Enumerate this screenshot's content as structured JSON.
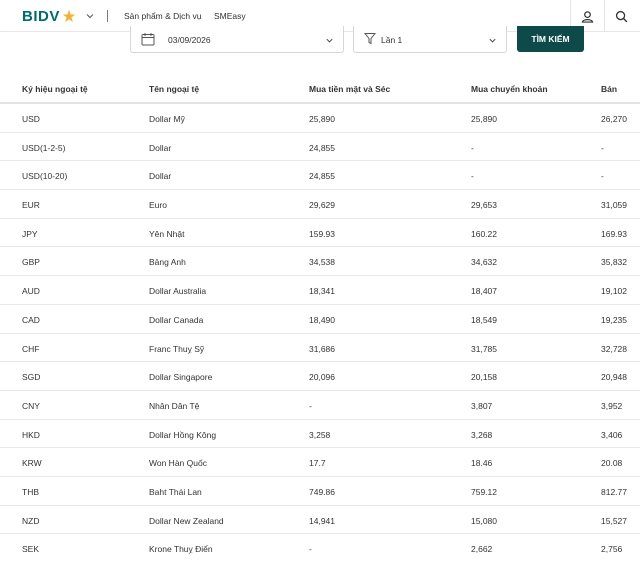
{
  "header": {
    "logo_text": "BIDV",
    "nav": [
      {
        "label": "Sản phẩm & Dịch vụ"
      },
      {
        "label": "SMEasy"
      }
    ]
  },
  "filter": {
    "date_value": "03/09/2026",
    "time_value": "Lần 1",
    "search_label": "TÌM KIẾM"
  },
  "colors": {
    "brand": "#006b68",
    "logo_star": "#f2b233",
    "button": "#0f4a4a"
  },
  "table": {
    "headers": [
      "Ký hiệu ngoại tệ",
      "Tên ngoại tệ",
      "Mua tiền mặt và Séc",
      "Mua chuyển khoản",
      "Bán"
    ],
    "rows": [
      {
        "code": "USD",
        "name": "Dollar Mỹ",
        "cash": "25,890",
        "transfer": "25,890",
        "sell": "26,270"
      },
      {
        "code": "USD(1-2-5)",
        "name": "Dollar",
        "cash": "24,855",
        "transfer": "-",
        "sell": "-"
      },
      {
        "code": "USD(10-20)",
        "name": "Dollar",
        "cash": "24,855",
        "transfer": "-",
        "sell": "-"
      },
      {
        "code": "EUR",
        "name": "Euro",
        "cash": "29,629",
        "transfer": "29,653",
        "sell": "31,059"
      },
      {
        "code": "JPY",
        "name": "Yên Nhật",
        "cash": "159.93",
        "transfer": "160.22",
        "sell": "169.93"
      },
      {
        "code": "GBP",
        "name": "Bảng Anh",
        "cash": "34,538",
        "transfer": "34,632",
        "sell": "35,832"
      },
      {
        "code": "AUD",
        "name": "Dollar Australia",
        "cash": "18,341",
        "transfer": "18,407",
        "sell": "19,102"
      },
      {
        "code": "CAD",
        "name": "Dollar Canada",
        "cash": "18,490",
        "transfer": "18,549",
        "sell": "19,235"
      },
      {
        "code": "CHF",
        "name": "Franc Thuỵ Sỹ",
        "cash": "31,686",
        "transfer": "31,785",
        "sell": "32,728"
      },
      {
        "code": "SGD",
        "name": "Dollar Singapore",
        "cash": "20,096",
        "transfer": "20,158",
        "sell": "20,948"
      },
      {
        "code": "CNY",
        "name": "Nhân Dân Tệ",
        "cash": "-",
        "transfer": "3,807",
        "sell": "3,952"
      },
      {
        "code": "HKD",
        "name": "Dollar Hồng Kông",
        "cash": "3,258",
        "transfer": "3,268",
        "sell": "3,406"
      },
      {
        "code": "KRW",
        "name": "Won Hàn Quốc",
        "cash": "17.7",
        "transfer": "18.46",
        "sell": "20.08"
      },
      {
        "code": "THB",
        "name": "Baht Thái Lan",
        "cash": "749.86",
        "transfer": "759.12",
        "sell": "812.77"
      },
      {
        "code": "NZD",
        "name": "Dollar New Zealand",
        "cash": "14,941",
        "transfer": "15,080",
        "sell": "15,527"
      },
      {
        "code": "SEK",
        "name": "Krone Thuỵ Điển",
        "cash": "-",
        "transfer": "2,662",
        "sell": "2,756"
      }
    ]
  }
}
